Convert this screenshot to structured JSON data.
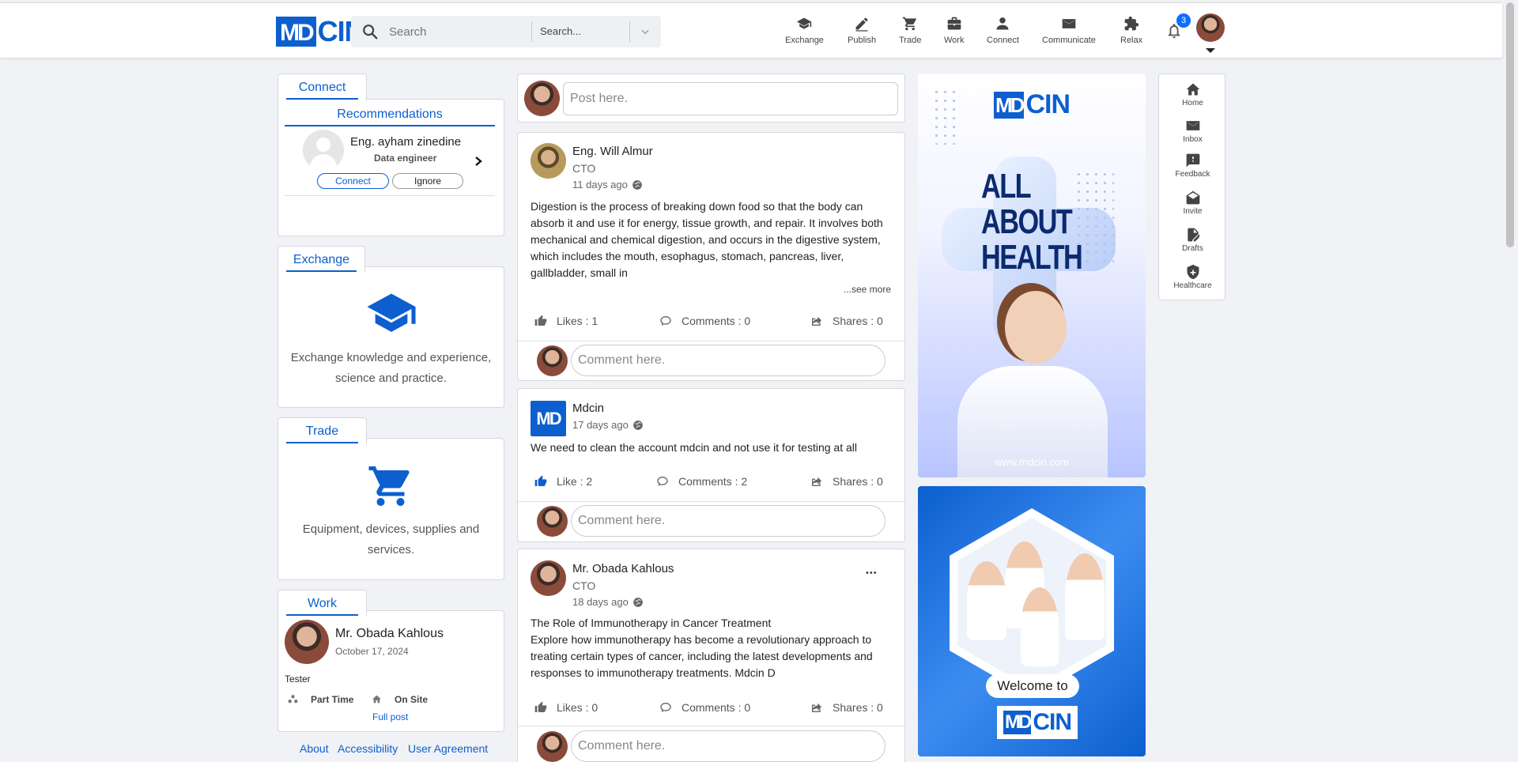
{
  "header": {
    "logo_md": "MD",
    "logo_cin": "CIN",
    "search_placeholder": "Search",
    "search_scope": "Search...",
    "nav": [
      {
        "label": "Exchange",
        "icon": "graduation-cap-icon"
      },
      {
        "label": "Publish",
        "icon": "pen-icon"
      },
      {
        "label": "Trade",
        "icon": "cart-icon"
      },
      {
        "label": "Work",
        "icon": "briefcase-icon"
      },
      {
        "label": "Connect",
        "icon": "person-icon"
      },
      {
        "label": "Communicate",
        "icon": "envelope-icon"
      },
      {
        "label": "Relax",
        "icon": "puzzle-icon"
      }
    ],
    "notification_count": "3"
  },
  "connect": {
    "tab": "Connect",
    "recommendations_title": "Recommendations",
    "person_name": "Eng. ayham zinedine",
    "person_role": "Data engineer",
    "connect_label": "Connect",
    "ignore_label": "Ignore"
  },
  "exchange": {
    "tab": "Exchange",
    "desc_line1": "Exchange knowledge and experience,",
    "desc_line2": "science and practice."
  },
  "trade": {
    "tab": "Trade",
    "desc_line1": "Equipment, devices, supplies and",
    "desc_line2": "services."
  },
  "work": {
    "tab": "Work",
    "name": "Mr. Obada Kahlous",
    "date": "October 17, 2024",
    "job_title": "Tester",
    "type": "Part Time",
    "location": "On Site",
    "link": "Full post"
  },
  "footer": {
    "about": "About",
    "accessibility": "Accessibility",
    "agreement": "User Agreement"
  },
  "composer": {
    "placeholder": "Post here."
  },
  "posts": [
    {
      "author": "Eng. Will Almur",
      "title": "CTO",
      "time": "11 days ago",
      "body_lines": [
        "Digestion is the process of breaking down food so that the body can",
        "absorb it and use it for energy, tissue growth, and repair. It involves both",
        "mechanical and chemical digestion, and occurs in the digestive system,",
        "which includes the mouth, esophagus, stomach, pancreas, liver,",
        "gallbladder, small in"
      ],
      "see_more": "...see more",
      "likes": "Likes : 1",
      "comments": "Comments : 0",
      "shares": "Shares : 0",
      "comment_placeholder": "Comment here."
    },
    {
      "author": "Mdcin",
      "avatar_text": "MD",
      "time": "17 days ago",
      "body_lines": [
        "We need to clean the account mdcin and not use it for testing at all"
      ],
      "likes": "Like : 2",
      "comments": "Comments : 2",
      "shares": "Shares : 0",
      "comment_placeholder": "Comment here."
    },
    {
      "author": "Mr. Obada Kahlous",
      "title": "CTO",
      "time": "18 days ago",
      "more": "•••",
      "body_lines": [
        "The Role of Immunotherapy in Cancer Treatment",
        "Explore how immunotherapy has become a revolutionary approach to",
        "treating certain types of cancer, including the latest developments and",
        "responses to immunotherapy treatments. Mdcin D"
      ],
      "likes": "Likes : 0",
      "comments": "Comments : 0",
      "shares": "Shares : 0",
      "comment_placeholder": "Comment here."
    }
  ],
  "ads": {
    "ad1_logo_md": "MD",
    "ad1_logo_cin": "CIN",
    "ad1_line1": "ALL",
    "ad1_line2": "ABOUT",
    "ad1_line3": "HEALTH",
    "ad1_url": "www.mdcin.com",
    "ad2_welcome": "Welcome to",
    "ad2_logo_md": "MD",
    "ad2_logo_cin": "CIN"
  },
  "side_menu": [
    {
      "label": "Home",
      "icon": "home-icon"
    },
    {
      "label": "Inbox",
      "icon": "envelope-icon"
    },
    {
      "label": "Feedback",
      "icon": "feedback-icon"
    },
    {
      "label": "Invite",
      "icon": "open-envelope-icon"
    },
    {
      "label": "Drafts",
      "icon": "draft-icon"
    },
    {
      "label": "Healthcare",
      "icon": "shield-icon"
    }
  ],
  "colors": {
    "brand": "#0d5fcf",
    "background": "#f0f2f5",
    "badge": "#0d6efd"
  }
}
